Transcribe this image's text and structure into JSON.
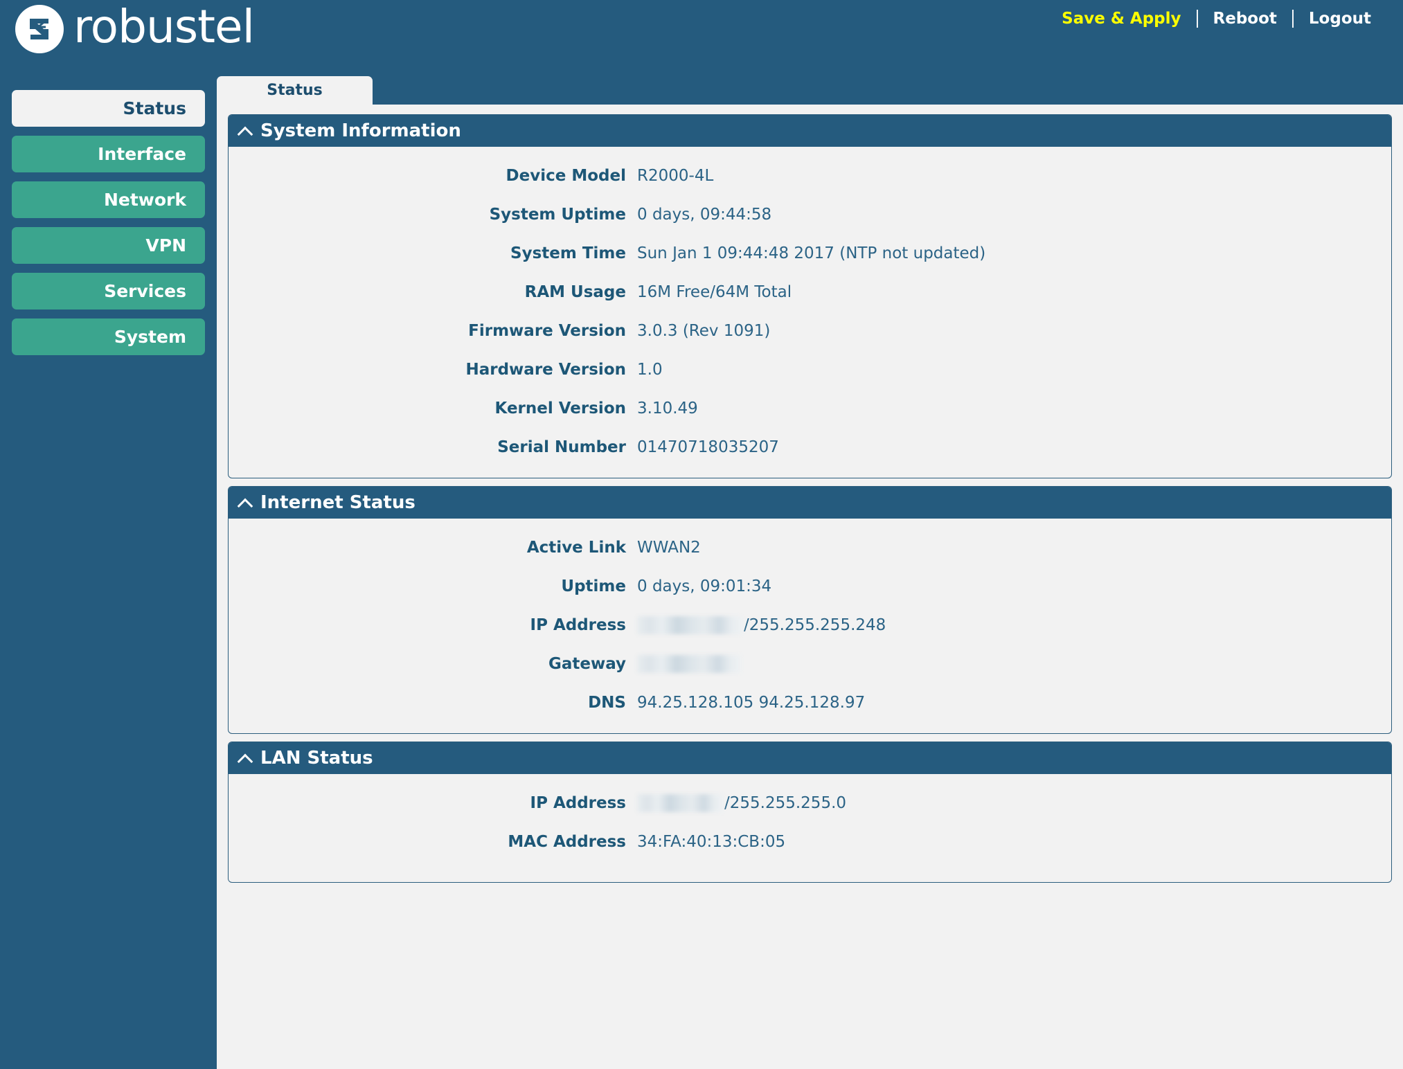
{
  "header": {
    "logo_text": "robustel",
    "logo_icon": "robustel-logo-icon",
    "actions": [
      {
        "label": "Save & Apply",
        "accent": "#ffff00",
        "name": "save-and-apply-link"
      },
      {
        "label": "Reboot",
        "accent": "#ffffff",
        "name": "reboot-link"
      },
      {
        "label": "Logout",
        "accent": "#ffffff",
        "name": "logout-link"
      }
    ]
  },
  "tabs": [
    {
      "label": "Status",
      "active": true
    }
  ],
  "sidebar": {
    "items": [
      {
        "label": "Status",
        "active": true
      },
      {
        "label": "Interface",
        "active": false
      },
      {
        "label": "Network",
        "active": false
      },
      {
        "label": "VPN",
        "active": false
      },
      {
        "label": "Services",
        "active": false
      },
      {
        "label": "System",
        "active": false
      }
    ]
  },
  "panels": [
    {
      "title": "System Information",
      "collapse_icon": "chevron-up-icon",
      "rows": [
        {
          "label": "Device Model",
          "value": "R2000-4L"
        },
        {
          "label": "System Uptime",
          "value": "0 days, 09:44:58"
        },
        {
          "label": "System Time",
          "value": "Sun Jan 1 09:44:48 2017 (NTP not updated)"
        },
        {
          "label": "RAM Usage",
          "value": "16M Free/64M Total"
        },
        {
          "label": "Firmware Version",
          "value": "3.0.3 (Rev 1091)"
        },
        {
          "label": "Hardware Version",
          "value": "1.0"
        },
        {
          "label": "Kernel Version",
          "value": "3.10.49"
        },
        {
          "label": "Serial Number",
          "value": "01470718035207"
        }
      ]
    },
    {
      "title": "Internet Status",
      "collapse_icon": "chevron-up-icon",
      "rows": [
        {
          "label": "Active Link",
          "value": "WWAN2"
        },
        {
          "label": "Uptime",
          "value": "0 days, 09:01:34"
        },
        {
          "label": "IP Address",
          "redacted": "w-wan",
          "value": "/255.255.255.248"
        },
        {
          "label": "Gateway",
          "redacted": "w-gw",
          "value": ""
        },
        {
          "label": "DNS",
          "value": "94.25.128.105 94.25.128.97"
        }
      ]
    },
    {
      "title": "LAN Status",
      "collapse_icon": "chevron-up-icon",
      "rows": [
        {
          "label": "IP Address",
          "redacted": "w-lan",
          "value": "/255.255.255.0"
        },
        {
          "label": "MAC Address",
          "value": "34:FA:40:13:CB:05"
        }
      ]
    }
  ],
  "colors": {
    "brand_dark": "#255b7e",
    "nav_green": "#3ba58e",
    "content_bg": "#f2f2f2",
    "accent_yellow": "#ffff00",
    "label_blue": "#1d5777"
  }
}
